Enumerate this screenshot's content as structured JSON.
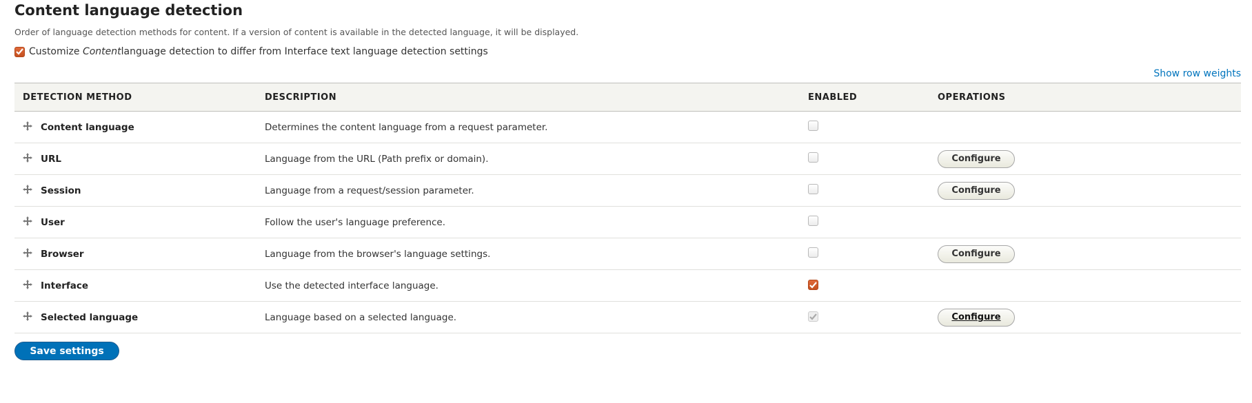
{
  "title": "Content language detection",
  "description": "Order of language detection methods for content. If a version of content is available in the detected language, it will be displayed.",
  "customize": {
    "pre": "Customize ",
    "em": "Content",
    "post": " language detection to differ from Interface text language detection settings",
    "checked": true
  },
  "show_row_weights": "Show row weights",
  "columns": [
    "DETECTION METHOD",
    "DESCRIPTION",
    "ENABLED",
    "OPERATIONS"
  ],
  "rows": [
    {
      "method": "Content language",
      "description": "Determines the content language from a request parameter.",
      "enabled": false,
      "disabled": false,
      "operation": null
    },
    {
      "method": "URL",
      "description": "Language from the URL (Path prefix or domain).",
      "enabled": false,
      "disabled": false,
      "operation": "Configure"
    },
    {
      "method": "Session",
      "description": "Language from a request/session parameter.",
      "enabled": false,
      "disabled": false,
      "operation": "Configure"
    },
    {
      "method": "User",
      "description": "Follow the user's language preference.",
      "enabled": false,
      "disabled": false,
      "operation": null
    },
    {
      "method": "Browser",
      "description": "Language from the browser's language settings.",
      "enabled": false,
      "disabled": false,
      "operation": "Configure"
    },
    {
      "method": "Interface",
      "description": "Use the detected interface language.",
      "enabled": true,
      "disabled": false,
      "operation": null
    },
    {
      "method": "Selected language",
      "description": "Language based on a selected language.",
      "enabled": true,
      "disabled": true,
      "operation": "Configure"
    }
  ],
  "save_label": "Save settings",
  "colors": {
    "accent": "#0071b8",
    "checkbox_on": "#c9531f",
    "link": "#0074bd"
  }
}
